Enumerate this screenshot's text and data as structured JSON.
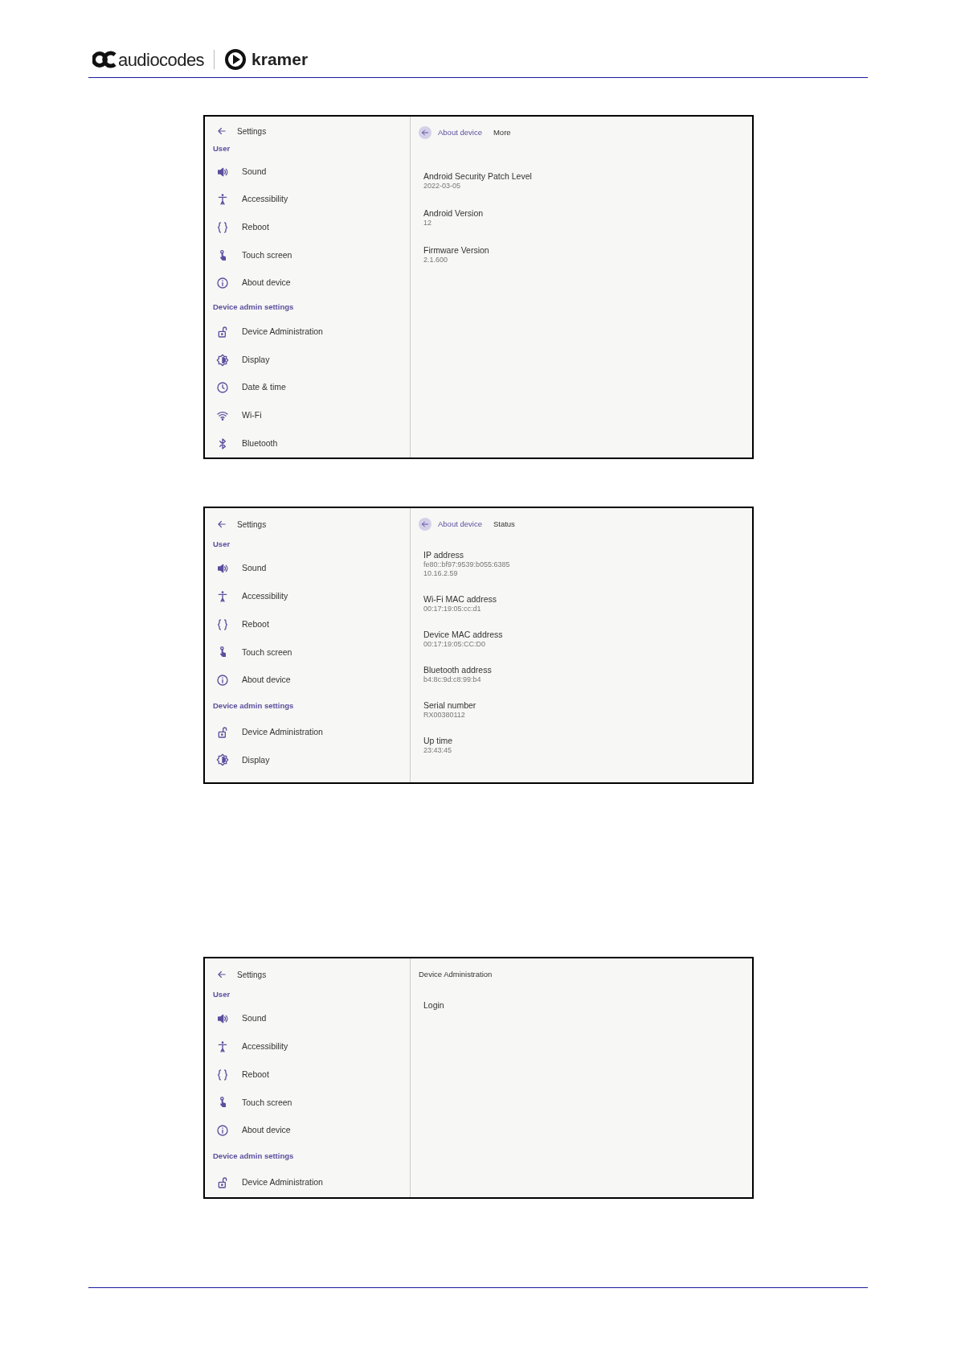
{
  "header": {
    "brand_left": "audiocodes",
    "brand_right": "kramer"
  },
  "screens": [
    {
      "sidebar": {
        "title": "Settings",
        "sections": [
          {
            "label": "User",
            "items": [
              "Sound",
              "Accessibility",
              "Reboot",
              "Touch screen",
              "About device"
            ]
          },
          {
            "label": "Device admin settings",
            "items": [
              "Device Administration",
              "Display",
              "Date & time",
              "Wi-Fi",
              "Bluetooth"
            ]
          }
        ]
      },
      "detail": {
        "kind": "subpage",
        "breadcrumb": "About device",
        "title": "More",
        "entries": [
          {
            "label": "Android Security Patch Level",
            "values": [
              "2022-03-05"
            ]
          },
          {
            "label": "Android Version",
            "values": [
              "12"
            ]
          },
          {
            "label": "Firmware Version",
            "values": [
              "2.1.600"
            ]
          }
        ]
      }
    },
    {
      "sidebar": {
        "title": "Settings",
        "sections": [
          {
            "label": "User",
            "items": [
              "Sound",
              "Accessibility",
              "Reboot",
              "Touch screen",
              "About device"
            ]
          },
          {
            "label": "Device admin settings",
            "items": [
              "Device Administration",
              "Display"
            ]
          }
        ]
      },
      "detail": {
        "kind": "subpage",
        "breadcrumb": "About device",
        "title": "Status",
        "entries": [
          {
            "label": "IP address",
            "values": [
              "fe80::bf97:9539:b055:6385",
              "10.16.2.59"
            ]
          },
          {
            "label": "Wi-Fi MAC address",
            "values": [
              "00:17:19:05:cc:d1"
            ]
          },
          {
            "label": "Device MAC address",
            "values": [
              "00:17:19:05:CC:D0"
            ]
          },
          {
            "label": "Bluetooth address",
            "values": [
              "b4:8c:9d:c8:99:b4"
            ]
          },
          {
            "label": "Serial number",
            "values": [
              "RX00380112"
            ]
          },
          {
            "label": "Up time",
            "values": [
              "23:43:45"
            ]
          }
        ]
      }
    },
    {
      "sidebar": {
        "title": "Settings",
        "sections": [
          {
            "label": "User",
            "items": [
              "Sound",
              "Accessibility",
              "Reboot",
              "Touch screen",
              "About device"
            ]
          },
          {
            "label": "Device admin settings",
            "items": [
              "Device Administration"
            ]
          }
        ]
      },
      "detail": {
        "kind": "plain",
        "title": "Device Administration",
        "entries": [
          {
            "label": "Login"
          }
        ]
      }
    }
  ]
}
